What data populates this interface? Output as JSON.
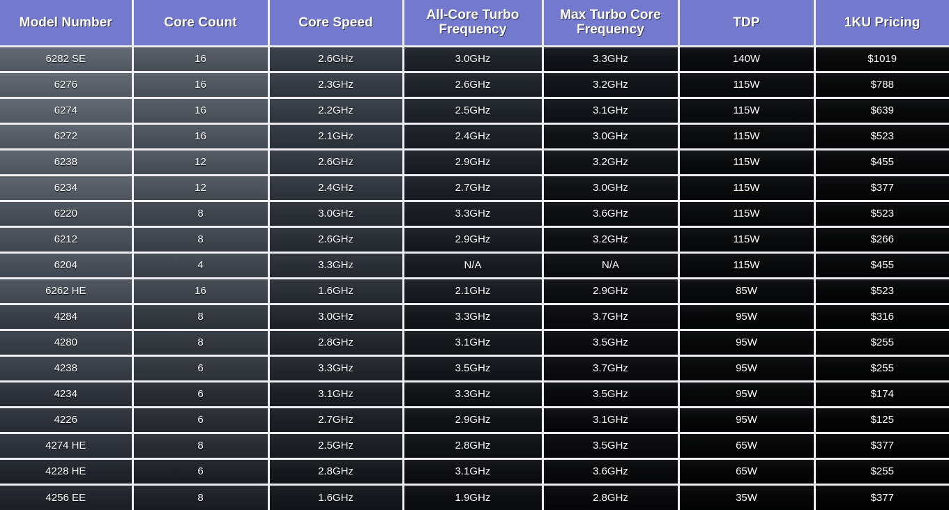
{
  "table": {
    "headers": [
      "Model Number",
      "Core Count",
      "Core Speed",
      "All-Core Turbo Frequency",
      "Max Turbo Core Frequency",
      "TDP",
      "1KU Pricing"
    ],
    "headers_lines": [
      [
        "Model Number"
      ],
      [
        "Core Count"
      ],
      [
        "Core Speed"
      ],
      [
        "All-Core Turbo",
        "Frequency"
      ],
      [
        "Max Turbo Core",
        "Frequency"
      ],
      [
        "TDP"
      ],
      [
        "1KU Pricing"
      ]
    ],
    "header_background": "#7379cd",
    "header_text_color": "#ffffff",
    "grid_line_color": "#eeeef2",
    "body_text_color": "#ffffff",
    "rows": [
      {
        "model": "6282 SE",
        "cores": "16",
        "speed": "2.6GHz",
        "all_core_turbo": "3.0GHz",
        "max_turbo": "3.3GHz",
        "tdp": "140W",
        "price": "$1019"
      },
      {
        "model": "6276",
        "cores": "16",
        "speed": "2.3GHz",
        "all_core_turbo": "2.6GHz",
        "max_turbo": "3.2GHz",
        "tdp": "115W",
        "price": "$788"
      },
      {
        "model": "6274",
        "cores": "16",
        "speed": "2.2GHz",
        "all_core_turbo": "2.5GHz",
        "max_turbo": "3.1GHz",
        "tdp": "115W",
        "price": "$639"
      },
      {
        "model": "6272",
        "cores": "16",
        "speed": "2.1GHz",
        "all_core_turbo": "2.4GHz",
        "max_turbo": "3.0GHz",
        "tdp": "115W",
        "price": "$523"
      },
      {
        "model": "6238",
        "cores": "12",
        "speed": "2.6GHz",
        "all_core_turbo": "2.9GHz",
        "max_turbo": "3.2GHz",
        "tdp": "115W",
        "price": "$455"
      },
      {
        "model": "6234",
        "cores": "12",
        "speed": "2.4GHz",
        "all_core_turbo": "2.7GHz",
        "max_turbo": "3.0GHz",
        "tdp": "115W",
        "price": "$377"
      },
      {
        "model": "6220",
        "cores": "8",
        "speed": "3.0GHz",
        "all_core_turbo": "3.3GHz",
        "max_turbo": "3.6GHz",
        "tdp": "115W",
        "price": "$523"
      },
      {
        "model": "6212",
        "cores": "8",
        "speed": "2.6GHz",
        "all_core_turbo": "2.9GHz",
        "max_turbo": "3.2GHz",
        "tdp": "115W",
        "price": "$266"
      },
      {
        "model": "6204",
        "cores": "4",
        "speed": "3.3GHz",
        "all_core_turbo": "N/A",
        "max_turbo": "N/A",
        "tdp": "115W",
        "price": "$455"
      },
      {
        "model": "6262 HE",
        "cores": "16",
        "speed": "1.6GHz",
        "all_core_turbo": "2.1GHz",
        "max_turbo": "2.9GHz",
        "tdp": "85W",
        "price": "$523"
      },
      {
        "model": "4284",
        "cores": "8",
        "speed": "3.0GHz",
        "all_core_turbo": "3.3GHz",
        "max_turbo": "3.7GHz",
        "tdp": "95W",
        "price": "$316"
      },
      {
        "model": "4280",
        "cores": "8",
        "speed": "2.8GHz",
        "all_core_turbo": "3.1GHz",
        "max_turbo": "3.5GHz",
        "tdp": "95W",
        "price": "$255"
      },
      {
        "model": "4238",
        "cores": "6",
        "speed": "3.3GHz",
        "all_core_turbo": "3.5GHz",
        "max_turbo": "3.7GHz",
        "tdp": "95W",
        "price": "$255"
      },
      {
        "model": "4234",
        "cores": "6",
        "speed": "3.1GHz",
        "all_core_turbo": "3.3GHz",
        "max_turbo": "3.5GHz",
        "tdp": "95W",
        "price": "$174"
      },
      {
        "model": "4226",
        "cores": "6",
        "speed": "2.7GHz",
        "all_core_turbo": "2.9GHz",
        "max_turbo": "3.1GHz",
        "tdp": "95W",
        "price": "$125"
      },
      {
        "model": "4274 HE",
        "cores": "8",
        "speed": "2.5GHz",
        "all_core_turbo": "2.8GHz",
        "max_turbo": "3.5GHz",
        "tdp": "65W",
        "price": "$377"
      },
      {
        "model": "4228 HE",
        "cores": "6",
        "speed": "2.8GHz",
        "all_core_turbo": "3.1GHz",
        "max_turbo": "3.6GHz",
        "tdp": "65W",
        "price": "$255"
      },
      {
        "model": "4256 EE",
        "cores": "8",
        "speed": "1.6GHz",
        "all_core_turbo": "1.9GHz",
        "max_turbo": "2.8GHz",
        "tdp": "35W",
        "price": "$377"
      }
    ]
  }
}
